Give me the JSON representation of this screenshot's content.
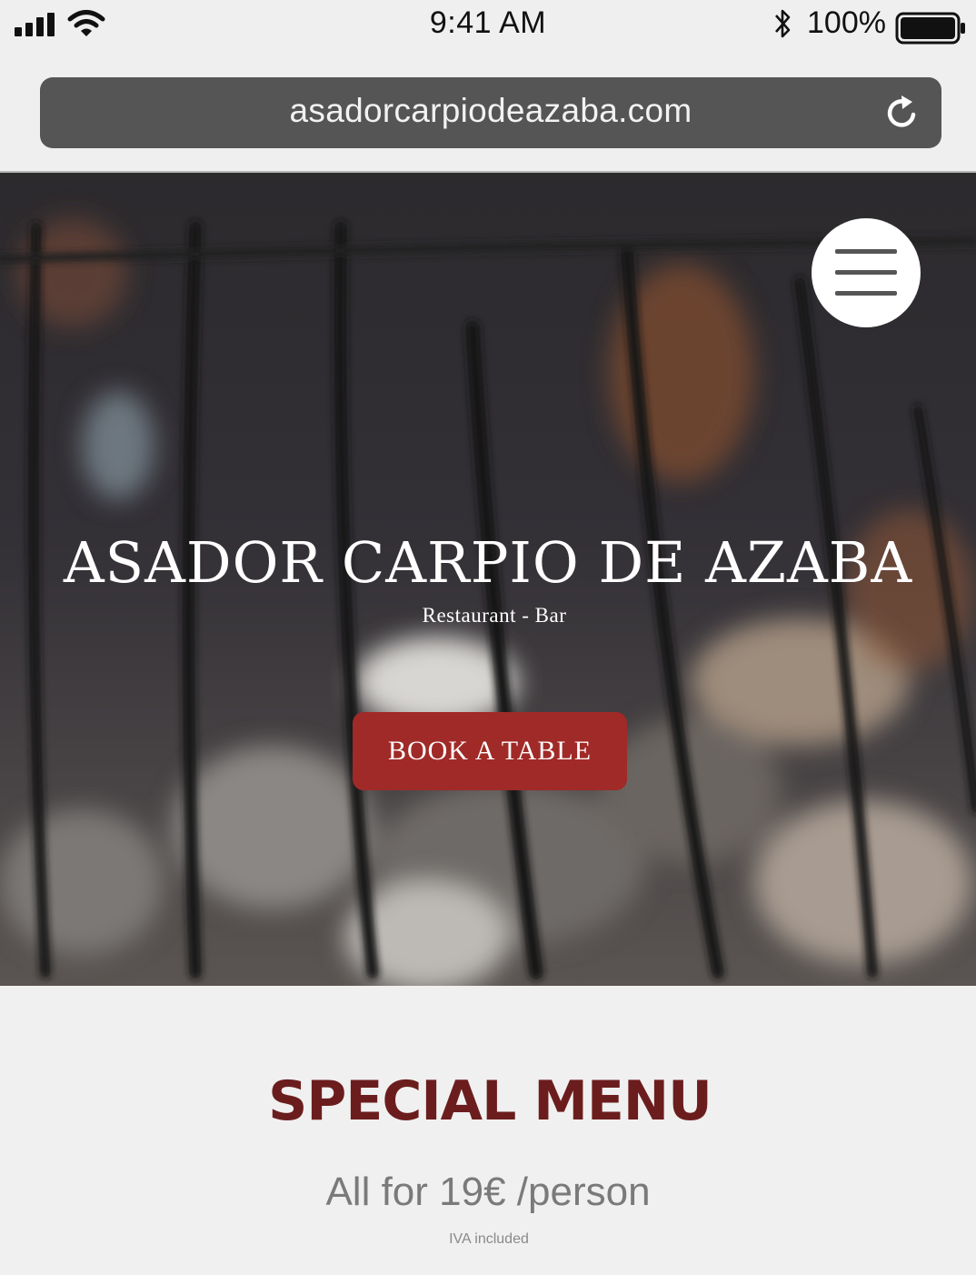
{
  "status_bar": {
    "time": "9:41 AM",
    "battery_percent": "100%",
    "icons": [
      "signal-icon",
      "wifi-icon",
      "bluetooth-icon",
      "battery-icon"
    ]
  },
  "browser": {
    "url": "asadorcarpiodeazaba.com",
    "reload_icon": "reload-icon"
  },
  "hero": {
    "title": "ASADOR CARPIO DE AZABA",
    "subtitle": "Restaurant - Bar",
    "cta_label": "BOOK A TABLE",
    "menu_icon": "hamburger-menu-icon"
  },
  "special_menu": {
    "title": "SPECIAL MENU",
    "price_text": "All for 19€ /person",
    "tax_note": "IVA included"
  },
  "colors": {
    "accent": "#a02a27",
    "title_red": "#6b1d1d",
    "url_bar": "#555555",
    "page_bg": "#efefef"
  }
}
